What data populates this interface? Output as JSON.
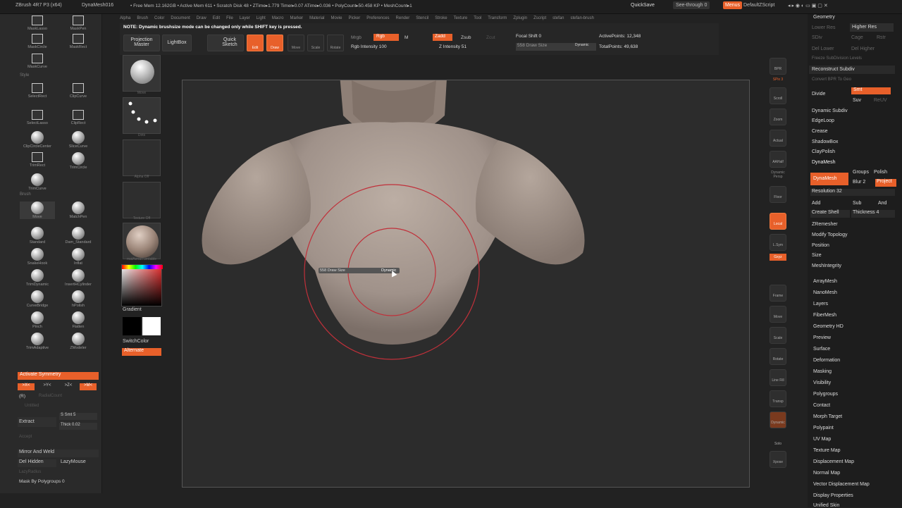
{
  "titlebar": {
    "app": "ZBrush 4R7 P3 (x64)",
    "doc": "DynaMesh016",
    "stats": "• Free Mem 12.162GB • Active Mem 611 • Scratch Disk 48 • ZTime▸1.779 Timer▸0.07 ATime▸0.036 • PolyCount▸50.458 KP • MeshCount▸1",
    "quicksave": "QuickSave",
    "seethrough": "See-through  0",
    "menus": "Menus",
    "script": "DefaultZScript"
  },
  "menubar": [
    "Alpha",
    "Brush",
    "Color",
    "Document",
    "Draw",
    "Edit",
    "File",
    "Layer",
    "Light",
    "Macro",
    "Marker",
    "Material",
    "Movie",
    "Picker",
    "Preferences",
    "Render",
    "Stencil",
    "Stroke",
    "Texture",
    "Tool",
    "Transform",
    "Zplugin",
    "Zscript",
    "stefan",
    "stefan-brush"
  ],
  "shelf": {
    "note": "NOTE: Dynamic brushsize mode can be changed only while SHIFT key is pressed.",
    "projection": "Projection Master",
    "lightbox": "LightBox",
    "quicksketch": "Quick Sketch",
    "edit": "Edit",
    "draw": "Draw",
    "move": "Move",
    "scale": "Scale",
    "rotate": "Rotate",
    "mrgb": "Mrgb",
    "rgb": "Rgb",
    "m": "M",
    "rgb_int": "Rgb Intensity 100",
    "zadd": "Zadd",
    "zsub": "Zsub",
    "zcut": "Zcut",
    "z_int": "Z Intensity 51",
    "focal": "Focal Shift 0",
    "drawsize": "558  Draw Size",
    "dynamic": "Dynamic",
    "active": "ActivePoints: 12,348",
    "total": "TotalPoints: 49,638"
  },
  "left": {
    "tools": [
      {
        "n": "MaskLasso"
      },
      {
        "n": "MaskPen"
      },
      {
        "n": "MaskCircle"
      },
      {
        "n": "MaskRect"
      },
      {
        "n": "MaskCurve"
      },
      {
        "n": "SelectRect"
      },
      {
        "n": "ClipCurve"
      },
      {
        "n": "SelectLasso"
      },
      {
        "n": "ClipRect"
      },
      {
        "n": "ClipCircleCenter"
      },
      {
        "n": "SliceCurve"
      },
      {
        "n": "TrimRect"
      },
      {
        "n": "TrimCircle"
      },
      {
        "n": "TrimCurve"
      },
      {
        "n": "Move"
      },
      {
        "n": "MatchPen"
      },
      {
        "n": "Standard"
      },
      {
        "n": "Dam_Standard"
      },
      {
        "n": "SnakeHook"
      },
      {
        "n": "Inflat"
      },
      {
        "n": "TrimDynamic"
      },
      {
        "n": "InsertHCylinder"
      },
      {
        "n": "CurveBridge"
      },
      {
        "n": "hPolish"
      },
      {
        "n": "Pinch"
      },
      {
        "n": "Flatten"
      },
      {
        "n": "TrimAdaptive"
      },
      {
        "n": "ZModeler"
      }
    ],
    "style": "Style",
    "brush": "Brush",
    "symmetry": "Activate Symmetry",
    "x": ">X<",
    "y": ">Y<",
    "z": ">Z<",
    "m": ">M<",
    "r": "(R)",
    "radial": "RadialCount",
    "untitled": "Untitled",
    "extract": "Extract",
    "smt": "S Smt 5",
    "thick": "Thick 0.02",
    "accept": "Accept",
    "mirror": "Mirror And Weld",
    "delhidden": "Del Hidden",
    "lazymouse": "LazyMouse",
    "lazyradius": "LazyRadius",
    "mask": "Mask By Polygroups 0"
  },
  "mid": {
    "move": "Move",
    "dots": "Dots",
    "alpha": "Alpha Off",
    "texture": "Texture Off",
    "mat": "matAerialTurntable",
    "gradient": "Gradient",
    "switch": "SwitchColor",
    "alternate": "Alternate"
  },
  "strip": [
    "BPR",
    "SPix 3",
    "Scroll",
    "Zoom",
    "Actual",
    "AAHalf",
    "Dynamic Persp",
    "Floor",
    "Local",
    "L.Sym",
    "Gxyz",
    "Frame",
    "Move",
    "Scale",
    "Rotate",
    "Line Fill PolyF",
    "Transp",
    "Dynamic Solo",
    "Xpose"
  ],
  "right": {
    "geometry": "Geometry",
    "lower_res": "Lower Res",
    "higher_res": "Higher Res",
    "sdiv": "SDiv",
    "cage": "Cage",
    "rstr": "Rstr",
    "del_lower": "Del Lower",
    "del_higher": "Del Higher",
    "freeze": "Freeze SubDivision Levels",
    "reconstruct": "Reconstruct Subdiv",
    "convert": "Convert BPR To Geo",
    "divide": "Divide",
    "smt": "Smt",
    "suv": "Suv",
    "reuv": "ReUV",
    "dynamic_subdiv": "Dynamic Subdiv",
    "edgeloop": "EdgeLoop",
    "crease": "Crease",
    "shadowbox": "ShadowBox",
    "claypolish": "ClayPolish",
    "dynamesh_head": "DynaMesh",
    "dynamesh_btn": "DynaMesh",
    "groups": "Groups",
    "polish": "Polish",
    "blur": "Blur 2",
    "project": "Project",
    "resolution": "Resolution 32",
    "add": "Add",
    "sub": "Sub",
    "and": "And",
    "create_shell": "Create Shell",
    "thickness": "Thickness 4",
    "zremesher": "ZRemesher",
    "modify": "Modify Topology",
    "position": "Position",
    "size": "Size",
    "meshint": "MeshIntegrity",
    "list": [
      "ArrayMesh",
      "NanoMesh",
      "Layers",
      "FiberMesh",
      "Geometry HD",
      "Preview",
      "Surface",
      "Deformation",
      "Masking",
      "Visibility",
      "Polygroups",
      "Contact",
      "Morph Target",
      "Polypaint",
      "UV Map",
      "Texture Map",
      "Displacement Map",
      "Normal Map",
      "Vector Displacement Map",
      "Display Properties",
      "Unified Skin"
    ]
  },
  "cursor": {
    "label": "558  Draw Size",
    "dynamic": "Dynamic"
  },
  "colors": {
    "accent": "#e8602a",
    "brush_ring": "#c0303a",
    "model": "#a5978e"
  }
}
